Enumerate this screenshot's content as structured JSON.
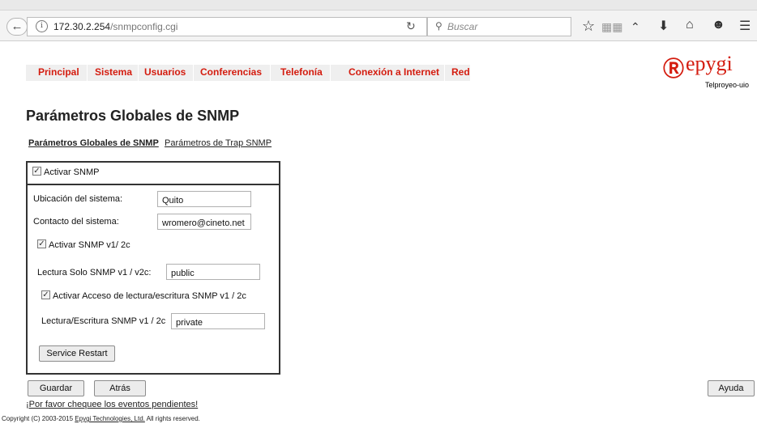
{
  "browser": {
    "url_host": "172.30.2.254",
    "url_path": "/snmpconfig.cgi",
    "search_placeholder": "Buscar"
  },
  "menu": {
    "items": [
      "Principal",
      "Sistema",
      "Usuarios",
      "Conferencias",
      "Telefonía",
      "Conexión a Internet",
      "Red"
    ]
  },
  "logo": {
    "brand": "epygi",
    "subtitle": "Telproyeo-uio"
  },
  "page": {
    "title": "Parámetros Globales de SNMP",
    "subtabs": [
      "Parámetros Globales de SNMP",
      "Parámetros de Trap SNMP"
    ]
  },
  "form": {
    "enable_snmp": {
      "label": "Activar SNMP",
      "checked": true
    },
    "location": {
      "label": "Ubicación del sistema:",
      "value": "Quito"
    },
    "contact": {
      "label": "Contacto del sistema:",
      "value": "wromero@cineto.net"
    },
    "enable_v1v2": {
      "label": "Activar SNMP v1/ 2c",
      "checked": true
    },
    "ro_community": {
      "label": "Lectura Solo SNMP v1 / v2c:",
      "value": "public"
    },
    "enable_rw": {
      "label": "Activar Acceso de lectura/escritura SNMP v1 / 2c",
      "checked": true
    },
    "rw_community": {
      "label": "Lectura/Escritura SNMP v1 / 2c",
      "value": "private"
    },
    "restart_label": "Service Restart"
  },
  "actions": {
    "save": "Guardar",
    "back": "Atrás",
    "help": "Ayuda"
  },
  "footer": {
    "pending_link": "¡Por favor chequee los eventos pendientes!",
    "copyright_prefix": "Copyright (C) 2003-2015 ",
    "copyright_company": "Epygi Technologies, Ltd.",
    "copyright_suffix": " All rights reserved."
  }
}
